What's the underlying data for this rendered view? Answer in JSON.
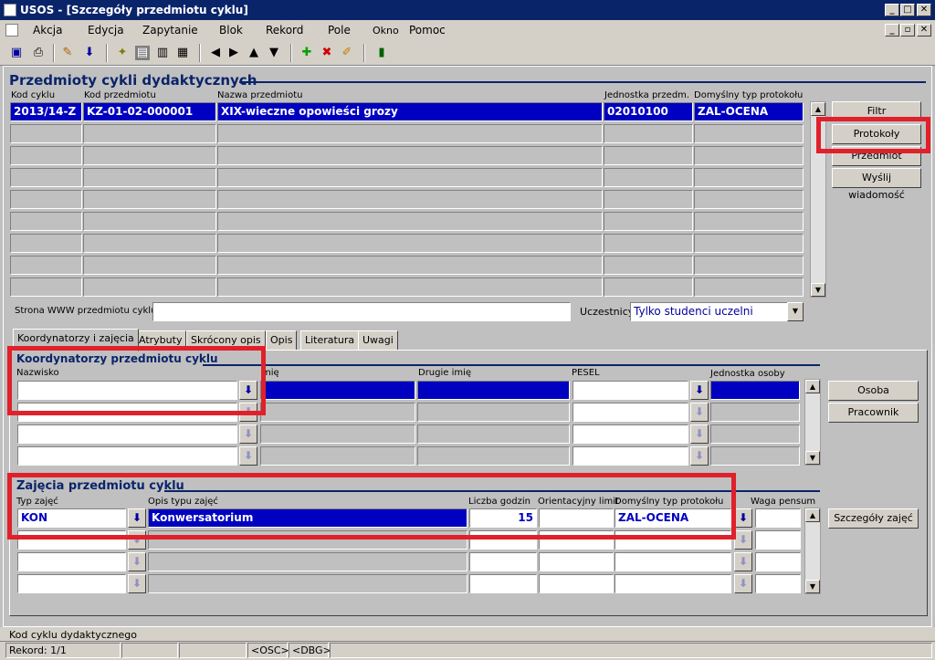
{
  "window": {
    "title": "USOS - [Szczegóły przedmiotu cyklu]",
    "min": "_",
    "max": "□",
    "close": "✕"
  },
  "menu": [
    "Akcja",
    "Edycja",
    "Zapytanie",
    "Blok",
    "Rekord",
    "Pole",
    "Okno",
    "Pomoc"
  ],
  "section1": {
    "title": "Przedmioty cykli dydaktycznych",
    "headers": [
      "Kod cyklu",
      "Kod przedmiotu",
      "Nazwa przedmiotu",
      "Jednostka przedm.",
      "Domyślny typ protokołu"
    ],
    "row": [
      "2013/14-Z",
      "KZ-01-02-000001",
      "XIX-wieczne opowieści grozy",
      "02010100",
      "ZAL-OCENA"
    ],
    "buttons": [
      "Filtr",
      "Protokoły przedm.",
      "Przedmiot",
      "Wyślij wiadomość"
    ]
  },
  "www_label": "Strona WWW przedmiotu cyklu",
  "www_value": "",
  "participants_label": "Uczestnicy",
  "participants_value": "Tylko studenci uczelni",
  "tabs": [
    "Koordynatorzy i zajęcia",
    "Atrybuty",
    "Skrócony opis",
    "Opis",
    "Literatura",
    "Uwagi"
  ],
  "coords": {
    "title": "Koordynatorzy przedmiotu cyklu",
    "headers": [
      "Nazwisko",
      "mię",
      "Drugie imię",
      "PESEL",
      "Jednostka osoby"
    ],
    "buttons": [
      "Osoba",
      "Pracownik"
    ]
  },
  "classes": {
    "title": "Zajęcia przedmiotu cyklu",
    "headers": [
      "Typ zajęć",
      "Opis typu zajęć",
      "Liczba godzin",
      "Orientacyjny limit",
      "Domyślny typ protokołu",
      "Waga pensum"
    ],
    "row": [
      "KON",
      "Konwersatorium",
      "15",
      "",
      "ZAL-OCENA",
      ""
    ],
    "button": "Szczegóły zajęć"
  },
  "status": {
    "hint": "Kod cyklu dydaktycznego",
    "record": "Rekord: 1/1",
    "osc": "<OSC>",
    "dbg": "<DBG>"
  },
  "colors": {
    "accent": "#0a246a",
    "selection": "#0000c0",
    "highlight": "#e0202a"
  }
}
